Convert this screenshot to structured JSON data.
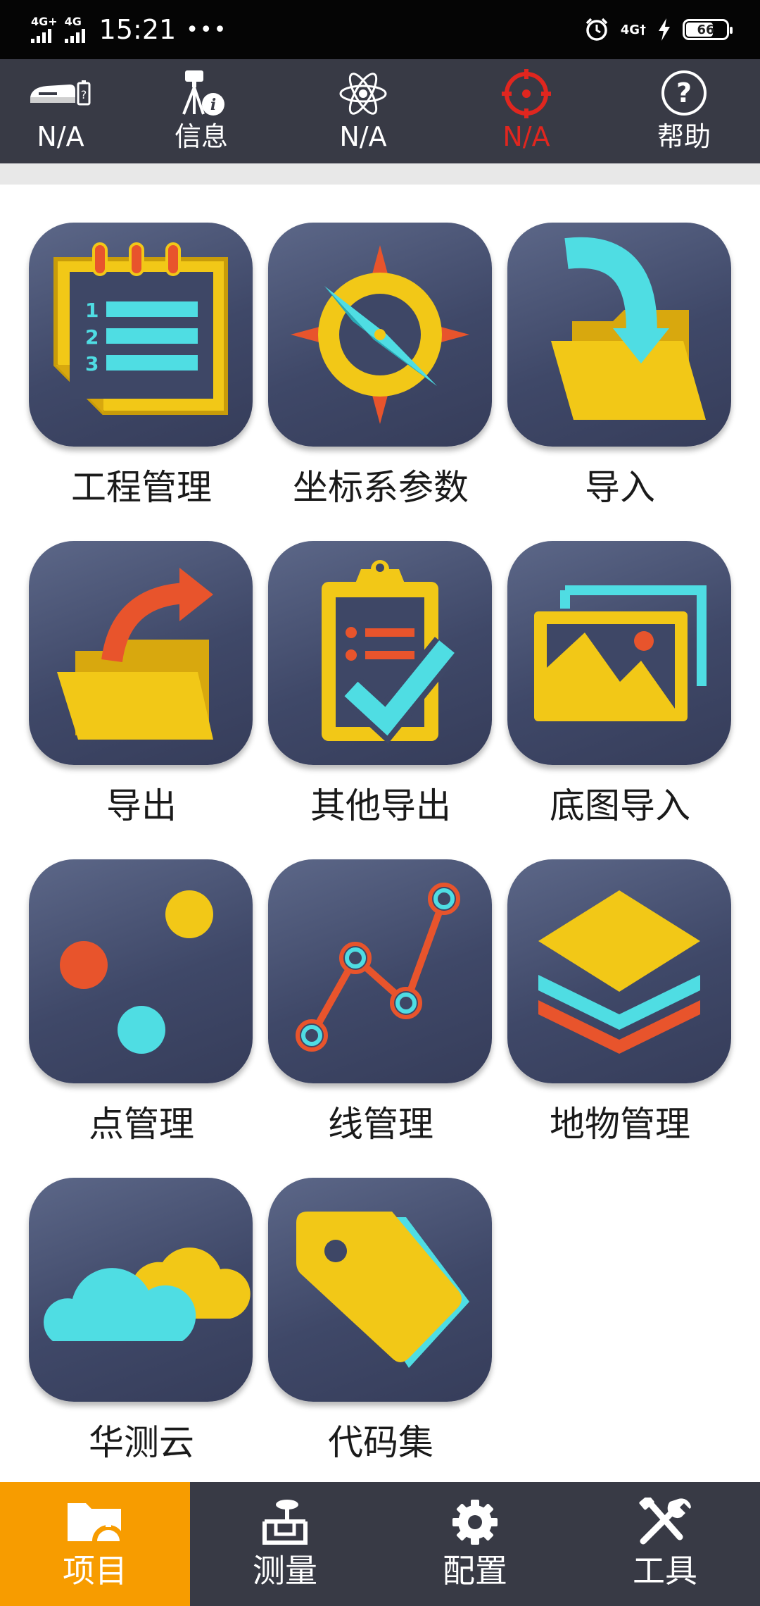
{
  "status_bar": {
    "sim1": "4G+",
    "sim2": "4G",
    "time": "15:21",
    "more": "•••",
    "net_right": "4G†",
    "battery": "66"
  },
  "top_toolbar": {
    "items": [
      {
        "label": "N/A",
        "icon": "receiver-battery-icon"
      },
      {
        "label": "信息",
        "icon": "rover-info-icon"
      },
      {
        "label": "N/A",
        "icon": "satellite-atom-icon"
      },
      {
        "label": "N/A",
        "icon": "crosshair-target-icon"
      },
      {
        "label": "帮助",
        "icon": "help-icon"
      }
    ],
    "active_color": "#e0261f"
  },
  "grid": {
    "tiles": [
      {
        "label": "工程管理",
        "icon": "project-notebook-icon"
      },
      {
        "label": "坐标系参数",
        "icon": "compass-icon"
      },
      {
        "label": "导入",
        "icon": "import-folder-icon"
      },
      {
        "label": "导出",
        "icon": "export-folder-icon"
      },
      {
        "label": "其他导出",
        "icon": "clipboard-check-icon"
      },
      {
        "label": "底图导入",
        "icon": "basemap-image-icon"
      },
      {
        "label": "点管理",
        "icon": "points-icon"
      },
      {
        "label": "线管理",
        "icon": "polyline-icon"
      },
      {
        "label": "地物管理",
        "icon": "layers-icon"
      },
      {
        "label": "华测云",
        "icon": "cloud-icon"
      },
      {
        "label": "代码集",
        "icon": "tag-icon"
      }
    ]
  },
  "bottom_nav": {
    "items": [
      {
        "label": "项目",
        "icon": "project-folder-icon",
        "active": true
      },
      {
        "label": "测量",
        "icon": "survey-icon",
        "active": false
      },
      {
        "label": "配置",
        "icon": "gear-icon",
        "active": false
      },
      {
        "label": "工具",
        "icon": "tools-icon",
        "active": false
      }
    ],
    "active_color": "#f79c00"
  },
  "colors": {
    "tile_bg": "#464f70",
    "yellow": "#f2c817",
    "cyan": "#4fdde3",
    "orange": "#e8542c"
  }
}
